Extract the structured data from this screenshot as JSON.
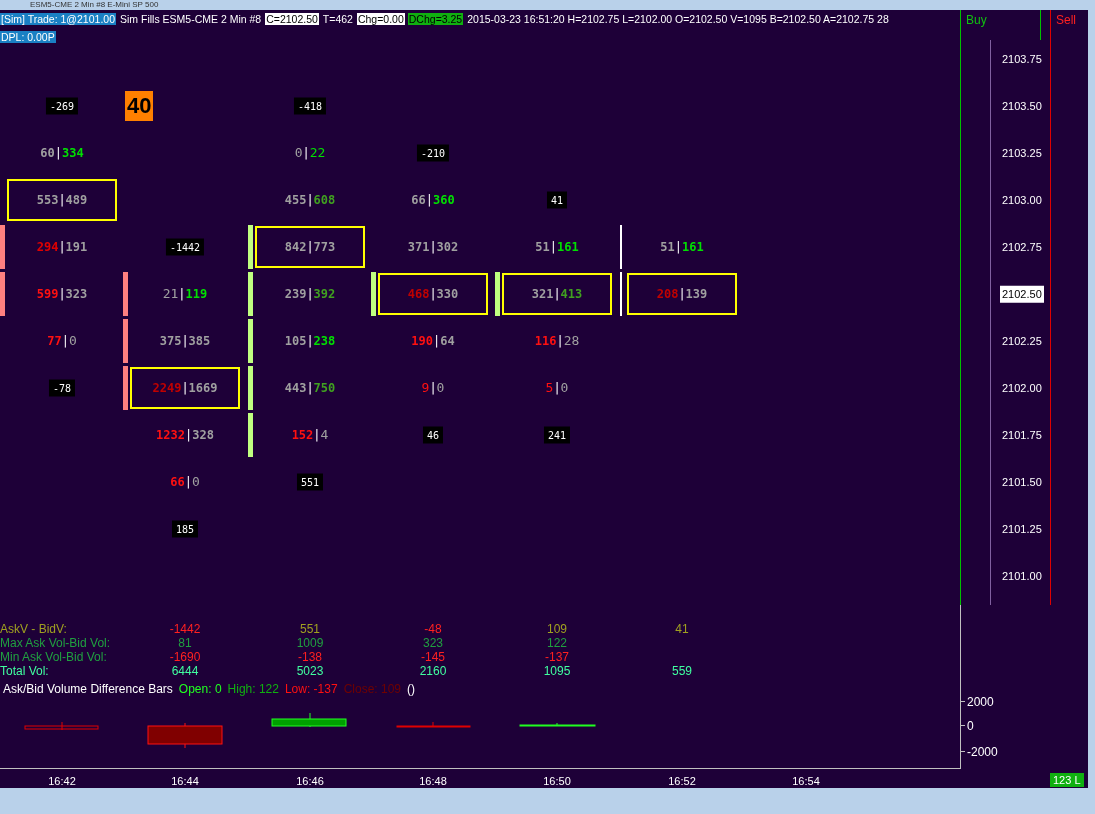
{
  "window": {
    "title": "ESM5-CME  2 Min  #8  E-Mini SP 500"
  },
  "header": {
    "items": [
      {
        "text": "[Sim]  Trade: 1@2101.00",
        "kind": "account"
      },
      {
        "text": "Sim Fills  ESM5-CME  2 Min  #8",
        "kind": "plain"
      },
      {
        "text": "C=2102.50",
        "kind": "highlight"
      },
      {
        "text": "T=462",
        "kind": "plain"
      },
      {
        "text": "Chg=0.00",
        "kind": "highlight"
      },
      {
        "text": "DChg=3.25",
        "kind": "up"
      },
      {
        "text": "2015-03-23 16:51:20 H=2102.75 L=2102.00 O=2102.50 V=1095 B=2102.50 A=2102.75 28",
        "kind": "plain"
      }
    ],
    "dpl": "DPL: 0.00P"
  },
  "buy_label": "Buy",
  "sell_label": "Sell",
  "separator": "|",
  "price_axis": [
    {
      "label": "2103.75",
      "selected": false
    },
    {
      "label": "2103.50",
      "selected": false
    },
    {
      "label": "2103.25",
      "selected": false
    },
    {
      "label": "2103.00",
      "selected": false
    },
    {
      "label": "2102.75",
      "selected": false
    },
    {
      "label": "2102.50",
      "selected": true
    },
    {
      "label": "2102.25",
      "selected": false
    },
    {
      "label": "2102.00",
      "selected": false
    },
    {
      "label": "2101.75",
      "selected": false
    },
    {
      "label": "2101.50",
      "selected": false
    },
    {
      "label": "2101.25",
      "selected": false
    },
    {
      "label": "2101.00",
      "selected": false
    }
  ],
  "stat_labels": [
    {
      "kind": "delta",
      "label": "AskV - BidV:",
      "color": "#a0a020"
    },
    {
      "kind": "max",
      "label": "Max Ask Vol-Bid Vol:",
      "color": "#20a040"
    },
    {
      "kind": "min",
      "label": "Min Ask Vol-Bid Vol:",
      "color": "#20a040"
    },
    {
      "kind": "total",
      "label": "Total Vol:",
      "color": "#40ffa0"
    }
  ],
  "columns": [
    {
      "rows": [
        null,
        {
          "kind": "delta",
          "text": "-269"
        },
        {
          "kind": "volume",
          "boxed": false,
          "ask": {
            "text": "60",
            "color": "#a0a0a0",
            "bold": true
          },
          "bid": {
            "text": "334",
            "color": "#00e000",
            "bold": true
          }
        },
        {
          "kind": "volume",
          "boxed": true,
          "ask": {
            "text": "553",
            "color": "#a0a0a0",
            "bold": true
          },
          "bid": {
            "text": "489",
            "color": "#a0a0a0",
            "bold": true
          }
        },
        {
          "kind": "volume",
          "boxed": false,
          "bar": {
            "color": "#ff8080"
          },
          "ask": {
            "text": "294",
            "color": "#e00000",
            "bold": true
          },
          "bid": {
            "text": "191",
            "color": "#a0a0a0",
            "bold": true
          }
        },
        {
          "kind": "volume",
          "boxed": false,
          "bar": {
            "color": "#ff8080"
          },
          "ask": {
            "text": "599",
            "color": "#ff1010",
            "bold": true
          },
          "bid": {
            "text": "323",
            "color": "#a0a0a0",
            "bold": true
          }
        },
        {
          "kind": "volume",
          "boxed": false,
          "ask": {
            "text": "77",
            "color": "#ff1010",
            "bold": true
          },
          "bid": {
            "text": "0",
            "color": "#a0a0a0",
            "bold": false
          }
        },
        {
          "kind": "delta",
          "text": "-78"
        }
      ]
    },
    {
      "rows": [
        null,
        {
          "kind": "count",
          "text": "40"
        },
        null,
        null,
        {
          "kind": "delta",
          "text": "-1442"
        },
        {
          "kind": "volume",
          "boxed": false,
          "bar": {
            "color": "#ff8080"
          },
          "ask": {
            "text": "21",
            "color": "#a0a0a0",
            "bold": false
          },
          "bid": {
            "text": "119",
            "color": "#00e000",
            "bold": true
          }
        },
        {
          "kind": "volume",
          "boxed": false,
          "bar": {
            "color": "#ff8080"
          },
          "ask": {
            "text": "375",
            "color": "#a0a0a0",
            "bold": true
          },
          "bid": {
            "text": "385",
            "color": "#a0a0a0",
            "bold": true
          }
        },
        {
          "kind": "volume",
          "boxed": true,
          "bar": {
            "color": "#ff8080"
          },
          "ask": {
            "text": "2249",
            "color": "#c00000",
            "bold": true
          },
          "bid": {
            "text": "1669",
            "color": "#a0a0a0",
            "bold": true
          }
        },
        {
          "kind": "volume",
          "boxed": false,
          "ask": {
            "text": "1232",
            "color": "#ff1010",
            "bold": true
          },
          "bid": {
            "text": "328",
            "color": "#a0a0a0",
            "bold": true
          }
        },
        {
          "kind": "volume",
          "boxed": false,
          "ask": {
            "text": "66",
            "color": "#ff1010",
            "bold": true
          },
          "bid": {
            "text": "0",
            "color": "#a0a0a0",
            "bold": false
          }
        },
        {
          "kind": "delta",
          "text": "185"
        }
      ],
      "stats": [
        {
          "kind": "delta",
          "text": "-1442",
          "color": "#ff2020"
        },
        {
          "kind": "max",
          "text": "81",
          "color": "#20a040"
        },
        {
          "kind": "min",
          "text": "-1690",
          "color": "#ff2020"
        },
        {
          "kind": "total",
          "text": "6444",
          "color": "#40ffa0"
        }
      ]
    },
    {
      "rows": [
        null,
        {
          "kind": "delta",
          "text": "-418"
        },
        {
          "kind": "volume",
          "boxed": false,
          "ask": {
            "text": "0",
            "color": "#a0a0a0",
            "bold": false
          },
          "bid": {
            "text": "22",
            "color": "#00e000",
            "bold": false
          }
        },
        {
          "kind": "volume",
          "boxed": false,
          "ask": {
            "text": "455",
            "color": "#a0a0a0",
            "bold": true
          },
          "bid": {
            "text": "608",
            "color": "#40a020",
            "bold": true
          }
        },
        {
          "kind": "volume",
          "boxed": true,
          "bar": {
            "color": "#c0ff80"
          },
          "ask": {
            "text": "842",
            "color": "#a0a0a0",
            "bold": true
          },
          "bid": {
            "text": "773",
            "color": "#a0a0a0",
            "bold": true
          }
        },
        {
          "kind": "volume",
          "boxed": false,
          "bar": {
            "color": "#c0ff80"
          },
          "ask": {
            "text": "239",
            "color": "#a0a0a0",
            "bold": true
          },
          "bid": {
            "text": "392",
            "color": "#40a020",
            "bold": true
          }
        },
        {
          "kind": "volume",
          "boxed": false,
          "bar": {
            "color": "#c0ff80"
          },
          "ask": {
            "text": "105",
            "color": "#a0a0a0",
            "bold": true
          },
          "bid": {
            "text": "238",
            "color": "#00e000",
            "bold": true
          }
        },
        {
          "kind": "volume",
          "boxed": false,
          "bar": {
            "color": "#c0ff80"
          },
          "ask": {
            "text": "443",
            "color": "#a0a0a0",
            "bold": true
          },
          "bid": {
            "text": "750",
            "color": "#40a020",
            "bold": true
          }
        },
        {
          "kind": "volume",
          "boxed": false,
          "bar": {
            "color": "#c0ff80"
          },
          "ask": {
            "text": "152",
            "color": "#ff1010",
            "bold": true
          },
          "bid": {
            "text": "4",
            "color": "#a0a0a0",
            "bold": false
          }
        },
        {
          "kind": "delta",
          "text": "551"
        }
      ],
      "stats": [
        {
          "kind": "delta",
          "text": "551",
          "color": "#a0a020"
        },
        {
          "kind": "max",
          "text": "1009",
          "color": "#20a040"
        },
        {
          "kind": "min",
          "text": "-138",
          "color": "#ff2020"
        },
        {
          "kind": "total",
          "text": "5023",
          "color": "#40ffa0"
        }
      ]
    },
    {
      "rows": [
        null,
        null,
        {
          "kind": "delta",
          "text": "-210"
        },
        {
          "kind": "volume",
          "boxed": false,
          "ask": {
            "text": "66",
            "color": "#a0a0a0",
            "bold": true
          },
          "bid": {
            "text": "360",
            "color": "#00e000",
            "bold": true
          }
        },
        {
          "kind": "volume",
          "boxed": false,
          "ask": {
            "text": "371",
            "color": "#a0a0a0",
            "bold": true
          },
          "bid": {
            "text": "302",
            "color": "#a0a0a0",
            "bold": true
          }
        },
        {
          "kind": "volume",
          "boxed": true,
          "bar": {
            "color": "#c0ff80"
          },
          "ask": {
            "text": "468",
            "color": "#c00000",
            "bold": true
          },
          "bid": {
            "text": "330",
            "color": "#a0a0a0",
            "bold": true
          }
        },
        {
          "kind": "volume",
          "boxed": false,
          "ask": {
            "text": "190",
            "color": "#ff1010",
            "bold": true
          },
          "bid": {
            "text": "64",
            "color": "#a0a0a0",
            "bold": true
          }
        },
        {
          "kind": "volume",
          "boxed": false,
          "ask": {
            "text": "9",
            "color": "#ff1010",
            "bold": false
          },
          "bid": {
            "text": "0",
            "color": "#a0a0a0",
            "bold": false
          }
        },
        {
          "kind": "delta",
          "text": "46"
        }
      ],
      "stats": [
        {
          "kind": "delta",
          "text": "-48",
          "color": "#ff2020"
        },
        {
          "kind": "max",
          "text": "323",
          "color": "#20a040"
        },
        {
          "kind": "min",
          "text": "-145",
          "color": "#ff2020"
        },
        {
          "kind": "total",
          "text": "2160",
          "color": "#40ffa0"
        }
      ]
    },
    {
      "rows": [
        null,
        null,
        null,
        {
          "kind": "delta",
          "text": "41"
        },
        {
          "kind": "volume",
          "boxed": false,
          "ask": {
            "text": "51",
            "color": "#a0a0a0",
            "bold": true
          },
          "bid": {
            "text": "161",
            "color": "#00e000",
            "bold": true
          }
        },
        {
          "kind": "volume",
          "boxed": true,
          "bar": {
            "color": "#c0ff80"
          },
          "ask": {
            "text": "321",
            "color": "#a0a0a0",
            "bold": true
          },
          "bid": {
            "text": "413",
            "color": "#40a020",
            "bold": true
          }
        },
        {
          "kind": "volume",
          "boxed": false,
          "ask": {
            "text": "116",
            "color": "#ff1010",
            "bold": true
          },
          "bid": {
            "text": "28",
            "color": "#a0a0a0",
            "bold": false
          }
        },
        {
          "kind": "volume",
          "boxed": false,
          "ask": {
            "text": "5",
            "color": "#ff1010",
            "bold": false
          },
          "bid": {
            "text": "0",
            "color": "#a0a0a0",
            "bold": false
          }
        },
        {
          "kind": "delta",
          "text": "241"
        }
      ],
      "stats": [
        {
          "kind": "delta",
          "text": "109",
          "color": "#a0a020"
        },
        {
          "kind": "max",
          "text": "122",
          "color": "#20a040"
        },
        {
          "kind": "min",
          "text": "-137",
          "color": "#ff2020"
        },
        {
          "kind": "total",
          "text": "1095",
          "color": "#40ffa0"
        }
      ]
    },
    {
      "rows": [
        null,
        null,
        null,
        null,
        {
          "kind": "volume",
          "boxed": false,
          "bar": {
            "color": "#ffffff"
          },
          "ask": {
            "text": "51",
            "color": "#a0a0a0",
            "bold": true
          },
          "bid": {
            "text": "161",
            "color": "#00e000",
            "bold": true
          }
        },
        {
          "kind": "volume",
          "boxed": true,
          "bar": {
            "color": "#ffffff"
          },
          "ask": {
            "text": "208",
            "color": "#c00000",
            "bold": true
          },
          "bid": {
            "text": "139",
            "color": "#a0a0a0",
            "bold": true
          }
        }
      ],
      "stats": [
        {
          "kind": "delta",
          "text": "41",
          "color": "#a0a020"
        },
        {
          "kind": "total",
          "text": "559",
          "color": "#40ffa0"
        }
      ]
    }
  ],
  "legend": [
    {
      "text": "Ask/Bid Volume Difference Bars",
      "color": "#ffffff"
    },
    {
      "text": "Open: 0",
      "color": "#20ff20"
    },
    {
      "text": "High: 122",
      "color": "#10b010"
    },
    {
      "text": "Low: -137",
      "color": "#ff1010"
    },
    {
      "text": "Close: 109",
      "color": "#700000"
    },
    {
      "text": "()",
      "color": "#ffffff"
    }
  ],
  "lower_axis": [
    "2000",
    "0",
    "-2000"
  ],
  "time_axis": [
    "16:42",
    "16:44",
    "16:46",
    "16:48",
    "16:50",
    "16:52",
    "16:54"
  ],
  "volume_badge": "123 L"
}
